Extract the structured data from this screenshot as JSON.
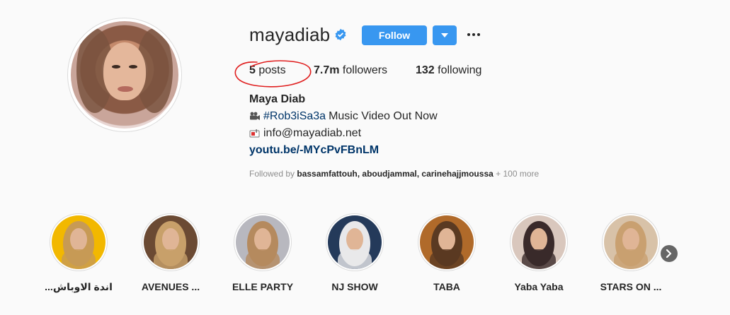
{
  "profile": {
    "username": "mayadiab",
    "verified_icon": "verified-badge-icon",
    "follow_label": "Follow",
    "dropdown_icon": "caret-down-icon",
    "more_icon": "ellipsis-icon",
    "stats": {
      "posts_count": "5",
      "posts_label": "posts",
      "followers_count": "7.7m",
      "followers_label": "followers",
      "following_count": "132",
      "following_label": "following"
    },
    "full_name": "Maya Diab",
    "bio": {
      "line1_icon": "movie-camera-icon",
      "line1_hashtag": "#Rob3iSa3a",
      "line1_text": "Music Video Out Now",
      "line2_icon": "mailbox-icon",
      "line2_text": "info@mayadiab.net"
    },
    "link": "youtu.be/-MYcPvFBnLM",
    "followed_by": {
      "prefix": "Followed by",
      "names": "bassamfattouh, aboudjammal, carinehajjmoussa",
      "suffix": "+ 100 more"
    },
    "accent_color": "#3897f0",
    "annotation_color": "#e02020"
  },
  "highlights": [
    {
      "label": "...اندة الاوباش",
      "bg": "#f2b800",
      "hair": "#c79a55"
    },
    {
      "label": "AVENUES ...",
      "bg": "#6b4a33",
      "hair": "#c8a06a"
    },
    {
      "label": "ELLE PARTY",
      "bg": "#b8b8bf",
      "hair": "#b58a5e"
    },
    {
      "label": "NJ SHOW",
      "bg": "#243a5a",
      "hair": "#e8e8ea"
    },
    {
      "label": "TABA",
      "bg": "#b06a2a",
      "hair": "#5a3a22"
    },
    {
      "label": "Yaba Yaba",
      "bg": "#d9c7bd",
      "hair": "#3a2a2a"
    },
    {
      "label": "STARS ON ...",
      "bg": "#d8c2a8",
      "hair": "#c9a070"
    }
  ],
  "next_icon": "chevron-right-icon"
}
